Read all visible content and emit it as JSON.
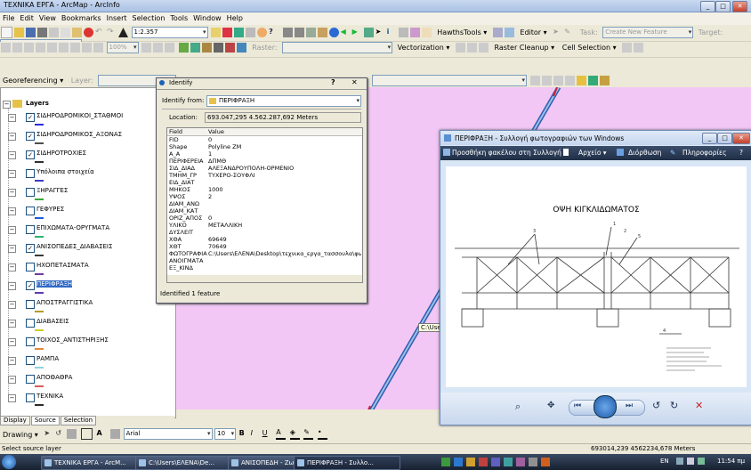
{
  "window": {
    "title": "ΤΕΧΝΙΚΑ ΕΡΓΑ - ArcMap - ArcInfo"
  },
  "menu": [
    "File",
    "Edit",
    "View",
    "Bookmarks",
    "Insert",
    "Selection",
    "Tools",
    "Window",
    "Help"
  ],
  "toolbar1": {
    "scale": "1:2.357",
    "hawths": "HawthsTools ▾",
    "editor": "Editor ▾",
    "task_label": "Task:",
    "task_value": "Create New Feature",
    "target_label": "Target:"
  },
  "toolbar2": {
    "zoom": "100%",
    "raster_label": "Raster:",
    "vectorization": "Vectorization ▾",
    "raster_cleanup": "Raster Cleanup ▾",
    "cell_selection": "Cell Selection ▾"
  },
  "toolbar3": {
    "georef": "Georeferencing ▾",
    "layer_label": "Layer:"
  },
  "toc": {
    "title": "Layers",
    "layers": [
      {
        "name": "ΣΙΔΗΡΟΔΡΟΜΙΚΟΙ_ΣΤΑΘΜΟΙ",
        "checked": true,
        "expanded": true,
        "color": "#2b2bd9"
      },
      {
        "name": "ΣΙΔΗΡΟΔΡΟΜΙΚΟΣ_ΑΞΟΝΑΣ",
        "checked": true,
        "expanded": true,
        "color": "#4d4d4d"
      },
      {
        "name": "ΣΙΔΗΡΟΤΡΟΧΙΕΣ",
        "checked": true,
        "expanded": true,
        "color": "#303030"
      },
      {
        "name": "Υπόλοιπα στοιχεία",
        "checked": false,
        "expanded": true,
        "color": "#3c3cc4"
      },
      {
        "name": "ΞΗΡΑΓΓΕΣ",
        "checked": false,
        "expanded": true,
        "color": "#3aa63a"
      },
      {
        "name": "ΓΕΦΥΡΕΣ",
        "checked": false,
        "expanded": true,
        "color": "#1c5fd6"
      },
      {
        "name": "ΕΠΙΧΩΜΑΤΑ-ΟΡΥΓΜΑΤΑ",
        "checked": false,
        "expanded": true,
        "color": "#2bb56b"
      },
      {
        "name": "ΑΝΙΣΟΠΕΔΕΣ_ΔΙΑΒΑΣΕΙΣ",
        "checked": true,
        "expanded": true,
        "color": "#3a3a3a"
      },
      {
        "name": "ΗΧΟΠΕΤΑΣΜΑΤΑ",
        "checked": false,
        "expanded": true,
        "color": "#6d3b9e"
      },
      {
        "name": "ΠΕΡΙΦΡΑΞΗ",
        "checked": true,
        "expanded": true,
        "color": "#5b3bb0",
        "selected": true
      },
      {
        "name": "ΑΠΟΣΤΡΑΓΓΙΣΤΙΚΑ",
        "checked": false,
        "expanded": true,
        "color": "#b59b2a"
      },
      {
        "name": "ΔΙΑΒΑΣΕΙΣ",
        "checked": false,
        "expanded": true,
        "color": "#cfcf2a"
      },
      {
        "name": "ΤΟΙΧΟΣ_ΑΝΤΙΣΤΗΡΙΞΗΣ",
        "checked": false,
        "expanded": true,
        "color": "#e08a3a"
      },
      {
        "name": "ΡΑΜΠΑ",
        "checked": false,
        "expanded": true,
        "color": "#8fd4e0"
      },
      {
        "name": "ΑΠΟΘΑΘΡΑ",
        "checked": false,
        "expanded": true,
        "color": "#d95a5a"
      },
      {
        "name": "ΤΕΧΝΙΚΑ",
        "checked": false,
        "expanded": true,
        "color": "#2a2a2a"
      }
    ],
    "tabs": [
      "Display",
      "Source",
      "Selection"
    ]
  },
  "identify": {
    "title": "Identify",
    "from_label": "Identify from:",
    "from_value": "ΠΕΡΙΦΡΑΞΗ",
    "location_label": "Location:",
    "location_value": "693.047,295  4.562.287,692 Meters",
    "col_field": "Field",
    "col_value": "Value",
    "rows": [
      [
        "FID",
        "0"
      ],
      [
        "Shape",
        "Polyline ZM"
      ],
      [
        "A_A",
        "1"
      ],
      [
        "ΠΕΡΙΦΕΡΕΙΑ",
        "ΔΠΜΘ"
      ],
      [
        "ΣΙΔ_ΔΙΑΔ",
        "ΑΛΕΞΑΝΔΡΟΥΠΟΛΗ-ΟΡΜΕΝΙΟ"
      ],
      [
        "ΤΜΗΜ_ΓΡ",
        "ΤΥΧΕΡΟ-ΣΟΥΦΛΙ"
      ],
      [
        "ΕΙΔ_ΔΙΑΤ",
        ""
      ],
      [
        "ΜΗΚΟΣ",
        "1000"
      ],
      [
        "ΥΨΟΣ",
        "2"
      ],
      [
        "ΔΙΑΜ_ΑΝΩ",
        ""
      ],
      [
        "ΔΙΑΜ_ΚΑΤ",
        ""
      ],
      [
        "ΟΡΙΖ_ΑΠΟΣ",
        "0"
      ],
      [
        "ΥΛΙΚΟ",
        "ΜΕΤΑΛΛΙΚΗ"
      ],
      [
        "ΔΥΣΛΕΙΤ",
        ""
      ],
      [
        "ΧΘΑ",
        "69649"
      ],
      [
        "ΧΘΤ",
        "70649"
      ],
      [
        "ΦΩΤΟΓΡΑΦΙΑ",
        "C:\\Users\\ΕΛΕΝΑ\\Desktop\\τεχνικα_εργα_τασσουλα\\φωτογρ"
      ],
      [
        "ΑΝΟΙΓΜΑΤΑ",
        ""
      ],
      [
        "ΕΞ_ΚΙΝΔ",
        ""
      ]
    ],
    "status": "Identified 1 feature"
  },
  "map": {
    "tooltip": "C:\\Users"
  },
  "viewer": {
    "title": "ΠΕΡΙΦΡΑΞΗ - Συλλογή φωτογραφιών των Windows",
    "menu": [
      "Προσθήκη φακέλου στη Συλλογή",
      "Αρχείο ▾",
      "Διόρθωση",
      "Πληροφορίες"
    ],
    "drawing_title": "ΟΨΗ ΚΙΓΚΛΙΔΩΜΑΤΟΣ",
    "callouts": [
      "3",
      "1",
      "2",
      "5",
      "4"
    ]
  },
  "drawbar": {
    "drawing": "Drawing ▾",
    "font": "Arial",
    "size": "10"
  },
  "statusbar": {
    "message": "Select source layer",
    "coords": "693014,239  4562234,678 Meters"
  },
  "taskbar": {
    "items": [
      "ΤΕΧΝΙΚΑ ΕΡΓΑ - ArcM...",
      "C:\\Users\\ΕΛΕΝΑ\\De...",
      "ΑΝΙΣΟΠΕΔΗ - Ζωγ...",
      "ΠΕΡΙΦΡΑΞΗ - Συλλο..."
    ],
    "lang": "EN",
    "time": "11:54 πμ"
  }
}
